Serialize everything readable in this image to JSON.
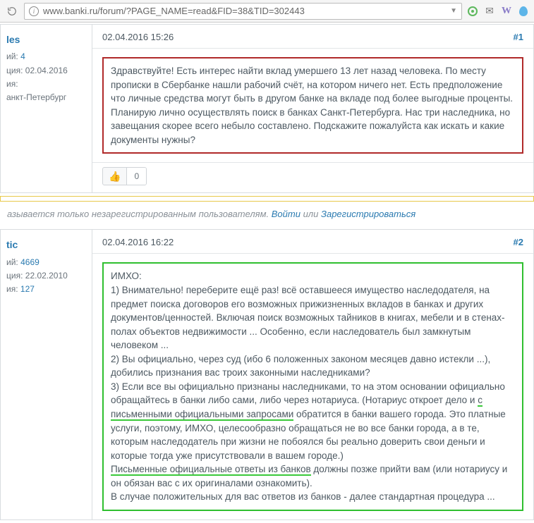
{
  "browser": {
    "url": "www.banki.ru/forum/?PAGE_NAME=read&FID=38&TID=302443"
  },
  "post1": {
    "username": "les",
    "messages_label": "ий:",
    "messages_count": "4",
    "reg_label": "ция:",
    "reg_date": "02.04.2016",
    "rep_label": "ия:",
    "city": "анкт-Петербург",
    "date": "02.04.2016 15:26",
    "num": "#1",
    "body": "Здравствуйте! Есть интерес найти вклад умершего 13 лет назад человека. По месту прописки в Сбербанке нашли рабочий счёт, на котором ничего нет. Есть предположение что личные средства могут быть в другом банке на вкладе под более выгодные проценты. Планирую лично осуществлять поиск в банках Санкт-Петербурга. Нас три наследника, но завещания скорее всего небыло составлено. Подскажите пожалуйста как искать и какие документы нужны?",
    "like_count": "0"
  },
  "guest": {
    "text_before": "азывается только незарегистрированным пользователям. ",
    "login": "Войти",
    "or": " или ",
    "register": "Зарегистрироваться"
  },
  "post2": {
    "username": "tic",
    "messages_label": "ий:",
    "messages_count": "4669",
    "reg_label": "ция:",
    "reg_date": "22.02.2010",
    "rep_label": "ия:",
    "rep_count": "127",
    "date": "02.04.2016 16:22",
    "num": "#2",
    "l0": "ИМХО:",
    "l1": "1) Внимательно! переберите ещё раз! всё оставшееся имущество наследодателя, на предмет поиска договоров его возможных прижизненных вкладов в банках и других документов/ценностей. Включая поиск возможных тайников в книгах, мебели и в стенах-полах объектов недвижимости ... Особенно, если наследователь был замкнутым человеком ...",
    "l2": "2) Вы официально, через суд (ибо 6 положенных законом месяцев давно истекли ...), добились признания вас троих законными наследниками?",
    "l3a": "3) Если все вы официально признаны наследниками, то на этом основании официально обращайтесь в банки либо сами, либо через нотариуса. (Нотариус откроет дело и ",
    "u1": "с письменными официальными запросами",
    "l3b": " обратится в банки вашего города. Это платные услуги, поэтому, ИМХО, целесообразно обращаться не во все банки города, а в те, которым наследодатель при жизни не побоялся бы реально доверить свои деньги и которые тогда уже присутствовали в вашем городе.)",
    "u2": "Письменные официальные ответы из банков",
    "l4": " должны позже прийти вам (или нотариусу и он обязан вас с их оригиналами ознакомить).",
    "l5": "В случае положительных для вас ответов из банков - далее стандартная процедура ..."
  }
}
